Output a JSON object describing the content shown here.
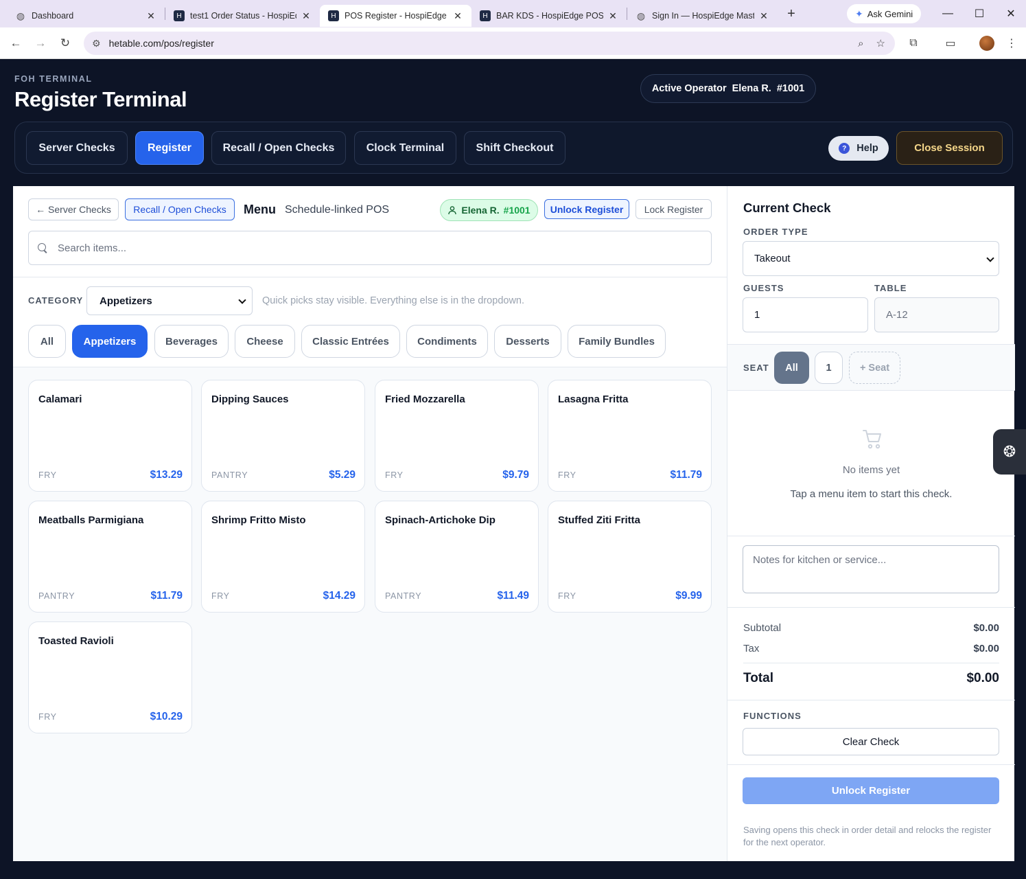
{
  "browser": {
    "tabs": [
      {
        "title": "Dashboard",
        "icon": "globe-icon"
      },
      {
        "title": "test1 Order Status - HospiEdge",
        "icon": "app-favicon"
      },
      {
        "title": "POS Register - HospiEdge POS",
        "icon": "app-favicon",
        "active": true
      },
      {
        "title": "BAR KDS - HospiEdge POS",
        "icon": "app-favicon"
      },
      {
        "title": "Sign In — HospiEdge Master",
        "icon": "globe-icon"
      }
    ],
    "gemini_label": "Ask Gemini",
    "url": "hetable.com/pos/register"
  },
  "header": {
    "eyebrow": "FOH TERMINAL",
    "title": "Register Terminal",
    "operator_label": "Active Operator",
    "operator_name": "Elena R.",
    "operator_id": "#1001"
  },
  "nav": {
    "items": [
      "Server Checks",
      "Register",
      "Recall / Open Checks",
      "Clock Terminal",
      "Shift Checkout"
    ],
    "active": "Register",
    "help": "Help",
    "close_session": "Close Session"
  },
  "toolbar": {
    "back": "← Server Checks",
    "recall": "Recall / Open Checks",
    "menu_title": "Menu",
    "menu_subtitle": "Schedule-linked POS",
    "operator_name": "Elena R.",
    "operator_id": "#1001",
    "unlock": "Unlock Register",
    "lock": "Lock Register",
    "search_placeholder": "Search items..."
  },
  "category": {
    "label": "CATEGORY",
    "selected": "Appetizers",
    "hint": "Quick picks stay visible. Everything else is in the dropdown.",
    "chips": [
      "All",
      "Appetizers",
      "Beverages",
      "Cheese",
      "Classic Entrées",
      "Condiments",
      "Desserts",
      "Family Bundles"
    ]
  },
  "items": [
    {
      "name": "Calamari",
      "station": "FRY",
      "price": "$13.29"
    },
    {
      "name": "Dipping Sauces",
      "station": "PANTRY",
      "price": "$5.29"
    },
    {
      "name": "Fried Mozzarella",
      "station": "FRY",
      "price": "$9.79"
    },
    {
      "name": "Lasagna Fritta",
      "station": "FRY",
      "price": "$11.79"
    },
    {
      "name": "Meatballs Parmigiana",
      "station": "PANTRY",
      "price": "$11.79"
    },
    {
      "name": "Shrimp Fritto Misto",
      "station": "FRY",
      "price": "$14.29"
    },
    {
      "name": "Spinach-Artichoke Dip",
      "station": "PANTRY",
      "price": "$11.49"
    },
    {
      "name": "Stuffed Ziti Fritta",
      "station": "FRY",
      "price": "$9.99"
    },
    {
      "name": "Toasted Ravioli",
      "station": "FRY",
      "price": "$10.29"
    }
  ],
  "check": {
    "title": "Current Check",
    "order_type_label": "ORDER TYPE",
    "order_type": "Takeout",
    "guests_label": "GUESTS",
    "guests": "1",
    "table_label": "TABLE",
    "table_placeholder": "A-12",
    "seat_label": "SEAT",
    "seats": [
      "All",
      "1"
    ],
    "add_seat": "+ Seat",
    "empty_title": "No items yet",
    "empty_sub": "Tap a menu item to start this check.",
    "notes_placeholder": "Notes for kitchen or service...",
    "subtotal_label": "Subtotal",
    "subtotal": "$0.00",
    "tax_label": "Tax",
    "tax": "$0.00",
    "total_label": "Total",
    "total": "$0.00",
    "functions_label": "FUNCTIONS",
    "clear": "Clear Check",
    "unlock": "Unlock Register",
    "footnote": "Saving opens this check in order detail and relocks the register for the next operator."
  },
  "colors": {
    "accent": "#2563eb",
    "app_bg": "#0d1426",
    "close_session_text": "#f6d78a",
    "operator_chip_bg": "#dcfce7"
  }
}
